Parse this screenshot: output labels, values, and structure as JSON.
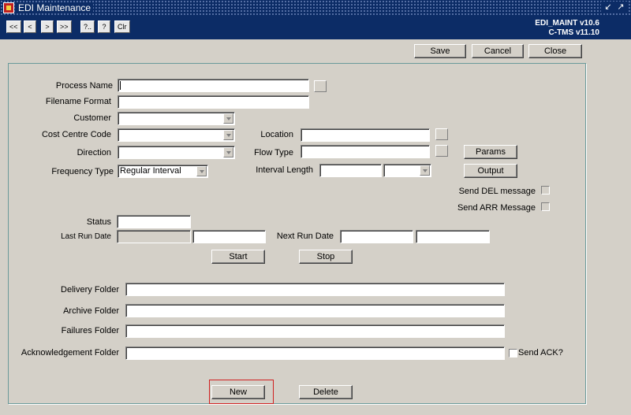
{
  "window": {
    "title": "EDI Maintenance",
    "controls": [
      "↙",
      "↗"
    ]
  },
  "toolbar": {
    "nav": [
      {
        "label": "<<",
        "name": "first-record-button"
      },
      {
        "label": "<",
        "name": "prev-record-button"
      },
      {
        "label": ">",
        "name": "next-record-button"
      },
      {
        "label": ">>",
        "name": "last-record-button"
      },
      {
        "label": "?..",
        "name": "query-button"
      },
      {
        "label": "?",
        "name": "help-button"
      },
      {
        "label": "Clr",
        "name": "clear-button"
      }
    ],
    "version1": "EDI_MAINT v10.6",
    "version2": "C-TMS v11.10"
  },
  "actions": {
    "save": "Save",
    "cancel": "Cancel",
    "close": "Close"
  },
  "form": {
    "process_name": {
      "label": "Process Name",
      "value": ""
    },
    "filename_format": {
      "label": "Filename Format",
      "value": ""
    },
    "customer": {
      "label": "Customer",
      "value": ""
    },
    "cost_centre_code": {
      "label": "Cost Centre Code",
      "value": ""
    },
    "location": {
      "label": "Location",
      "value": ""
    },
    "direction": {
      "label": "Direction",
      "value": ""
    },
    "flow_type": {
      "label": "Flow Type",
      "value": ""
    },
    "params_button": "Params",
    "frequency_type": {
      "label": "Frequency Type",
      "value": "Regular Interval"
    },
    "interval_length": {
      "label": "Interval Length",
      "value": "",
      "unit": ""
    },
    "output_button": "Output",
    "send_del": {
      "label": "Send DEL message",
      "checked": false
    },
    "send_arr": {
      "label": "Send ARR Message",
      "checked": false
    },
    "status": {
      "label": "Status",
      "value": ""
    },
    "last_run_date": {
      "label": "Last Run Date",
      "date": "",
      "time": ""
    },
    "next_run_date": {
      "label": "Next Run Date",
      "date": "",
      "time": ""
    },
    "start_button": "Start",
    "stop_button": "Stop",
    "delivery_folder": {
      "label": "Delivery Folder",
      "value": ""
    },
    "archive_folder": {
      "label": "Archive Folder",
      "value": ""
    },
    "failures_folder": {
      "label": "Failures Folder",
      "value": ""
    },
    "ack_folder": {
      "label": "Acknowledgement Folder",
      "value": ""
    },
    "send_ack": {
      "label": "Send ACK?",
      "checked": false
    },
    "new_button": "New",
    "delete_button": "Delete"
  }
}
